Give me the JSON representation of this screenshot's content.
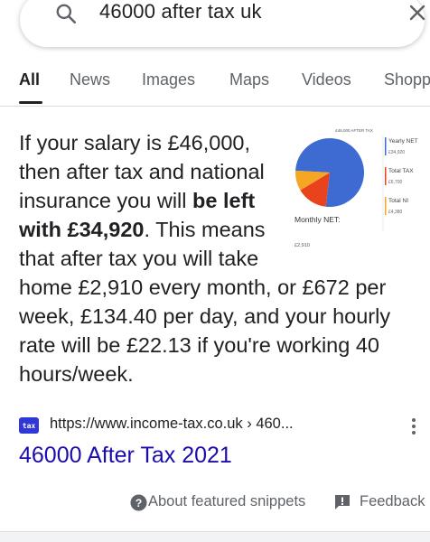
{
  "search": {
    "query": "46000 after tax uk",
    "icon": "search-icon",
    "clear_icon": "close-icon"
  },
  "tabs": [
    {
      "label": "All",
      "active": true
    },
    {
      "label": "News",
      "active": false
    },
    {
      "label": "Images",
      "active": false
    },
    {
      "label": "Maps",
      "active": false
    },
    {
      "label": "Videos",
      "active": false
    },
    {
      "label": "Shopp",
      "active": false
    }
  ],
  "snippet": {
    "text_1": "If your salary is £46,000, then after tax and national insurance you will ",
    "bold": "be left with £34,920",
    "text_2": ". This means that after tax you will take home £2,910 every month, or £672 per week, £134.40 per day, and your hourly rate will be £22.13 if you're working 40 hours/week."
  },
  "chart_data": {
    "type": "pie",
    "title": "£46,000 AFTER TAX",
    "categories": [
      "Yearly NET",
      "Total TAX",
      "Total NI"
    ],
    "values": [
      34920,
      6700,
      4380
    ],
    "value_labels": [
      "£34,920",
      "£6,700",
      "£4,380"
    ],
    "colors": [
      "#3d6bd1",
      "#e8431c",
      "#f5a623"
    ],
    "legend_position": "right",
    "annotation_label": "Monthly NET:",
    "annotation_value": "£2,910"
  },
  "source": {
    "favicon_text": "tax",
    "url": "https://www.income-tax.co.uk › 460...",
    "more_icon": "more-vert-icon"
  },
  "result": {
    "title": "46000 After Tax 2021"
  },
  "footer": {
    "about_label": "About featured snippets",
    "feedback_label": "Feedback"
  },
  "colors": {
    "link": "#1a0dab",
    "favicon_bg": "#2f37d4",
    "muted": "#5f6368"
  }
}
